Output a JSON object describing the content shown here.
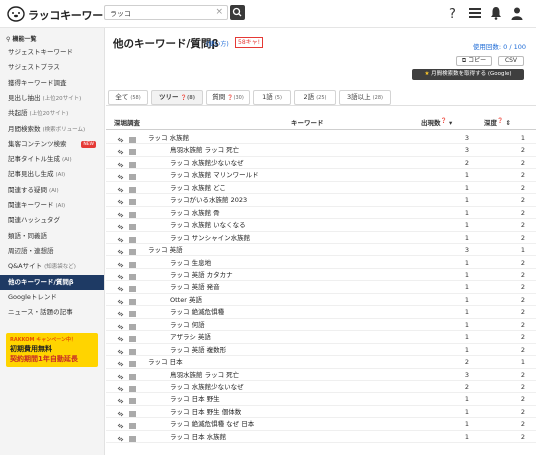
{
  "header": {
    "logo_text": "ラッコキーワード",
    "search_value": "ラッコ",
    "clear": "×"
  },
  "sidebar": {
    "heading": "機能一覧",
    "items": [
      {
        "label": "サジェストキーワード",
        "sub": ""
      },
      {
        "label": "サジェストプラス",
        "sub": ""
      },
      {
        "label": "獲得キーワード調査",
        "sub": ""
      },
      {
        "label": "見出し抽出",
        "sub": "(上位20サイト)"
      },
      {
        "label": "共起語",
        "sub": "(上位20サイト)"
      },
      {
        "label": "月間検索数",
        "sub": "(検索ボリューム)"
      },
      {
        "label": "集客コンテンツ検索",
        "sub": "",
        "badge": "NEW"
      },
      {
        "label": "記事タイトル生成",
        "sub": "(AI)"
      },
      {
        "label": "記事見出し生成",
        "sub": "(AI)"
      },
      {
        "label": "関連する疑問",
        "sub": "(AI)"
      },
      {
        "label": "関連キーワード",
        "sub": "(AI)"
      },
      {
        "label": "関連ハッシュタグ",
        "sub": ""
      },
      {
        "label": "類語・同義語",
        "sub": ""
      },
      {
        "label": "周辺語・連想語",
        "sub": ""
      },
      {
        "label": "Q&Aサイト",
        "sub": "(知恵袋など)"
      },
      {
        "label": "他のキーワード/質問β",
        "sub": "",
        "active": true
      },
      {
        "label": "Googleトレンド",
        "sub": ""
      },
      {
        "label": "ニュース・話題の記事",
        "sub": ""
      }
    ],
    "banner": {
      "line1": "RAKKOM キャンペーン中！",
      "line2": "初期費用無料",
      "line3": "契約期間1年自動延長"
    }
  },
  "main": {
    "title": "他のキーワード/質問β",
    "usage_link": "(使い方)",
    "limit_badge": "58キャ!",
    "usage_count": "使用回数: 0 / 100",
    "copy_label": "コピー",
    "csv_label": "CSV",
    "monthly_label": "月間検索数を取得する (Google)",
    "tabs": [
      {
        "label": "全て",
        "count": "(58)"
      },
      {
        "label": "ツリー",
        "count": "(8)"
      },
      {
        "label": "質問",
        "count": "(30)"
      },
      {
        "label": "1語",
        "count": "(5)"
      },
      {
        "label": "2語",
        "count": "(25)"
      },
      {
        "label": "3語以上",
        "count": "(28)"
      }
    ],
    "columns": {
      "check": "深堀調査",
      "keyword": "キーワード",
      "hits": "出現数",
      "depth": "深度"
    },
    "rows": [
      {
        "keyword": "ラッコ 水族館",
        "level": 0,
        "hits": "3",
        "depth": "1"
      },
      {
        "keyword": "鳥羽水族館 ラッコ 死亡",
        "level": 1,
        "hits": "3",
        "depth": "2"
      },
      {
        "keyword": "ラッコ 水族館少ないなぜ",
        "level": 1,
        "hits": "2",
        "depth": "2"
      },
      {
        "keyword": "ラッコ 水族館 マリンワールド",
        "level": 1,
        "hits": "1",
        "depth": "2"
      },
      {
        "keyword": "ラッコ 水族館 どこ",
        "level": 1,
        "hits": "1",
        "depth": "2"
      },
      {
        "keyword": "ラッコがいる水族館 2023",
        "level": 1,
        "hits": "1",
        "depth": "2"
      },
      {
        "keyword": "ラッコ 水族館 骨",
        "level": 1,
        "hits": "1",
        "depth": "2"
      },
      {
        "keyword": "ラッコ 水族館 いなくなる",
        "level": 1,
        "hits": "1",
        "depth": "2"
      },
      {
        "keyword": "ラッコ サンシャイン水族館",
        "level": 1,
        "hits": "1",
        "depth": "2"
      },
      {
        "keyword": "ラッコ 英語",
        "level": 0,
        "hits": "3",
        "depth": "1"
      },
      {
        "keyword": "ラッコ 生息地",
        "level": 1,
        "hits": "1",
        "depth": "2"
      },
      {
        "keyword": "ラッコ 英語 カタカナ",
        "level": 1,
        "hits": "1",
        "depth": "2"
      },
      {
        "keyword": "ラッコ 英語 発音",
        "level": 1,
        "hits": "1",
        "depth": "2"
      },
      {
        "keyword": "Otter 英語",
        "level": 1,
        "hits": "1",
        "depth": "2"
      },
      {
        "keyword": "ラッコ 絶滅危惧種",
        "level": 1,
        "hits": "1",
        "depth": "2"
      },
      {
        "keyword": "ラッコ 何語",
        "level": 1,
        "hits": "1",
        "depth": "2"
      },
      {
        "keyword": "アザラシ 英語",
        "level": 1,
        "hits": "1",
        "depth": "2"
      },
      {
        "keyword": "ラッコ 英語 複数形",
        "level": 1,
        "hits": "1",
        "depth": "2"
      },
      {
        "keyword": "ラッコ 日本",
        "level": 0,
        "hits": "2",
        "depth": "1"
      },
      {
        "keyword": "鳥羽水族館 ラッコ 死亡",
        "level": 1,
        "hits": "3",
        "depth": "2"
      },
      {
        "keyword": "ラッコ 水族館少ないなぜ",
        "level": 1,
        "hits": "2",
        "depth": "2"
      },
      {
        "keyword": "ラッコ 日本 野生",
        "level": 1,
        "hits": "1",
        "depth": "2"
      },
      {
        "keyword": "ラッコ 日本 野生 個体数",
        "level": 1,
        "hits": "1",
        "depth": "2"
      },
      {
        "keyword": "ラッコ 絶滅危惧種 なぜ 日本",
        "level": 1,
        "hits": "1",
        "depth": "2"
      },
      {
        "keyword": "ラッコ 日本 水族館",
        "level": 1,
        "hits": "1",
        "depth": "2"
      }
    ]
  }
}
